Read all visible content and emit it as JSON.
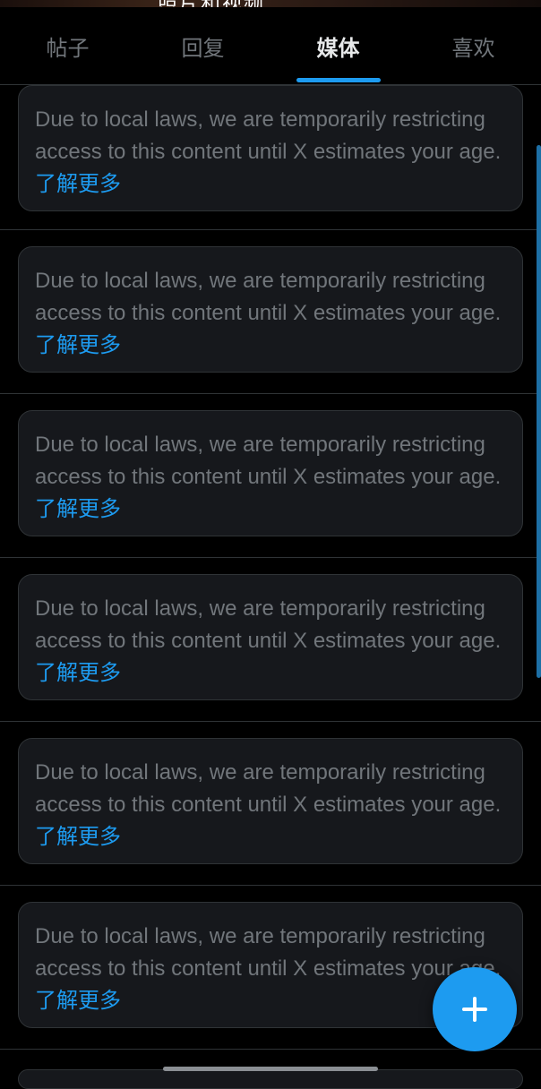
{
  "header": {
    "partial_title": "照片和视频"
  },
  "tabs": [
    {
      "label": "帖子",
      "active": false
    },
    {
      "label": "回复",
      "active": false
    },
    {
      "label": "媒体",
      "active": true
    },
    {
      "label": "喜欢",
      "active": false
    }
  ],
  "notice": {
    "text": "Due to local laws, we are temporarily restricting access to this content until X estimates your age.",
    "link_label": "了解更多"
  },
  "posts_count_visible": 6,
  "fab": {
    "icon": "plus-icon"
  },
  "colors": {
    "accent": "#1d9bf0",
    "background": "#000000",
    "card": "#16181c",
    "muted_text": "#71767b",
    "divider": "#2f3336"
  }
}
